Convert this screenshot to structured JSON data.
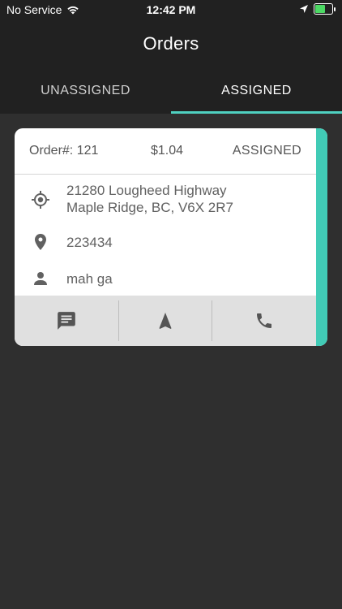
{
  "status_bar": {
    "carrier": "No Service",
    "time": "12:42 PM"
  },
  "header": {
    "title": "Orders"
  },
  "tabs": [
    {
      "label": "UNASSIGNED",
      "active": false
    },
    {
      "label": "ASSIGNED",
      "active": true
    }
  ],
  "order": {
    "number": "Order#: 121",
    "price": "$1.04",
    "status": "ASSIGNED",
    "address_line1": "21280 Lougheed Highway",
    "address_line2": "Maple Ridge, BC, V6X 2R7",
    "location": "223434",
    "customer": "mah ga"
  },
  "actions": [
    {
      "icon": "message-icon"
    },
    {
      "icon": "navigation-icon"
    },
    {
      "icon": "phone-icon"
    }
  ],
  "colors": {
    "accent": "#41cbb6",
    "background": "#2f2f2f",
    "header": "#212121",
    "battery": "#4cd964"
  }
}
